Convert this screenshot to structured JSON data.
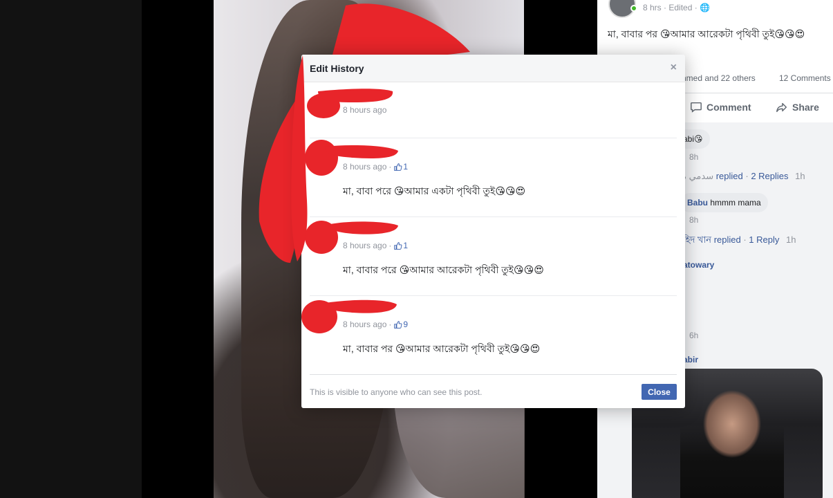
{
  "modal": {
    "title": "Edit History",
    "close_x": "×",
    "footer_note": "This is visible to anyone who can see this post.",
    "close_button": "Close",
    "revisions": [
      {
        "time": "8 hours ago",
        "likes": "",
        "text": ""
      },
      {
        "time": "8 hours ago",
        "likes": "1",
        "text": "মা, বাবা পরে 😘আমার একটা পৃথিবী তুই😘😘😍"
      },
      {
        "time": "8 hours ago",
        "likes": "1",
        "text": "মা, বাবার পরে 😘আমার আরেকটা পৃথিবী তুই😘😘😍"
      },
      {
        "time": "8 hours ago",
        "likes": "9",
        "text": "মা, বাবার পর 😘আমার আরেকটা পৃথিবী তুই😘😘😍"
      }
    ]
  },
  "post": {
    "meta_time": "8 hrs",
    "meta_edited": "Edited",
    "caption": "মা, বাবার পর 😘আমার আরেকটা পৃথিবী তুই😘😘😍",
    "reactions_text": "hmed and 22 others",
    "comments_count": "12 Comments",
    "actions": {
      "comment": "Comment",
      "share": "Share"
    },
    "comments": [
      {
        "text": "abi😘"
      },
      {
        "time": "8h"
      },
      {
        "name": "ﺳﺪﻣﻲ ﻣ",
        "replied": "replied",
        "replies": "2 Replies",
        "time": "1h"
      },
      {
        "name": "Babu",
        "text": "hmmm mama"
      },
      {
        "time": "8h"
      },
      {
        "name": "হিদ খান",
        "replied": "replied",
        "replies": "1 Reply",
        "time": "1h"
      },
      {
        "name": "atowary"
      },
      {
        "time": "6h"
      },
      {
        "name": "abir"
      }
    ]
  }
}
